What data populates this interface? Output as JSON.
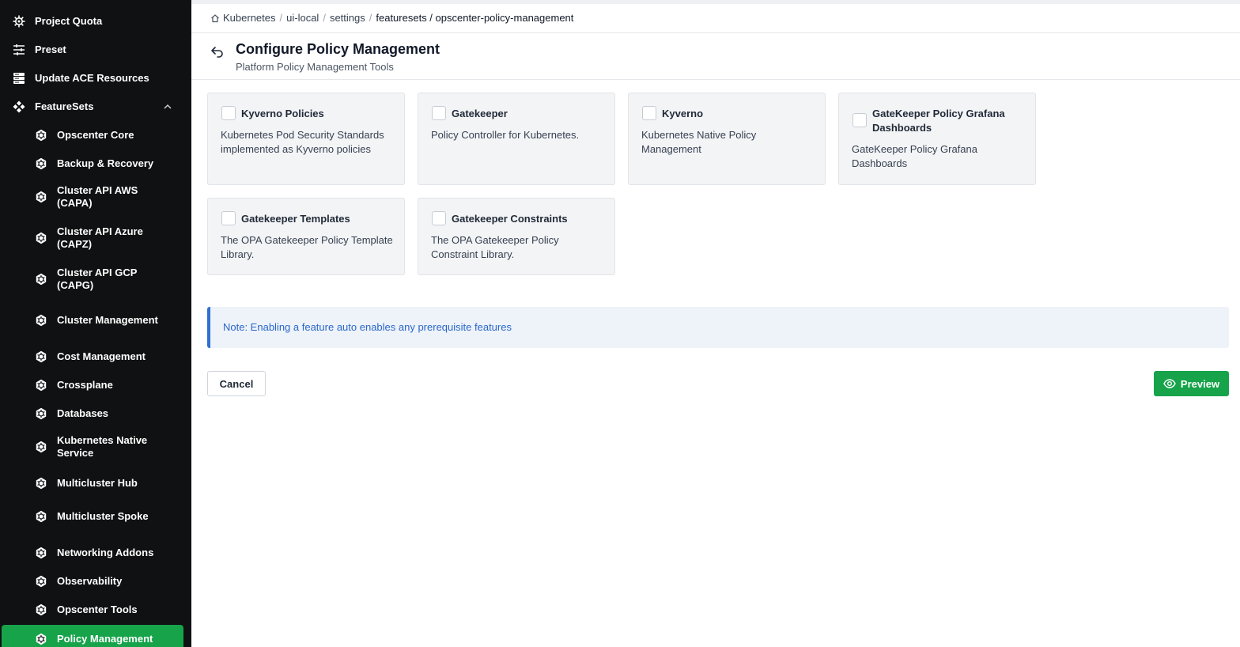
{
  "sidebar": {
    "top_items": [
      {
        "label": "Project Quota",
        "icon": "helm-wheel-icon"
      },
      {
        "label": "Preset",
        "icon": "sliders-icon"
      },
      {
        "label": "Update ACE Resources",
        "icon": "server-stack-icon"
      },
      {
        "label": "FeatureSets",
        "icon": "featuresets-icon",
        "expanded": true
      }
    ],
    "featuresets": [
      {
        "label": "Opscenter Core"
      },
      {
        "label": "Backup & Recovery"
      },
      {
        "label": "Cluster API AWS (CAPA)"
      },
      {
        "label": "Cluster API Azure (CAPZ)"
      },
      {
        "label": "Cluster API GCP (CAPG)"
      },
      {
        "label": "Cluster Management"
      },
      {
        "label": "Cost Management"
      },
      {
        "label": "Crossplane"
      },
      {
        "label": "Databases"
      },
      {
        "label": "Kubernetes Native Service"
      },
      {
        "label": "Multicluster Hub"
      },
      {
        "label": "Multicluster Spoke"
      },
      {
        "label": "Networking Addons"
      },
      {
        "label": "Observability"
      },
      {
        "label": "Opscenter Tools"
      },
      {
        "label": "Policy Management",
        "active": true
      }
    ]
  },
  "breadcrumb": [
    "Kubernetes",
    "ui-local",
    "settings",
    "featuresets / opscenter-policy-management"
  ],
  "header": {
    "title": "Configure Policy Management",
    "subtitle": "Platform Policy Management Tools"
  },
  "features": [
    {
      "title": "Kyverno Policies",
      "description": "Kubernetes Pod Security Standards implemented as Kyverno policies",
      "checked": false
    },
    {
      "title": "Gatekeeper",
      "description": "Policy Controller for Kubernetes.",
      "checked": false
    },
    {
      "title": "Kyverno",
      "description": "Kubernetes Native Policy Management",
      "checked": false
    },
    {
      "title": "GateKeeper Policy Grafana Dashboards",
      "description": "GateKeeper Policy Grafana Dashboards",
      "checked": false
    },
    {
      "title": "Gatekeeper Templates",
      "description": "The OPA Gatekeeper Policy Template Library.",
      "checked": false
    },
    {
      "title": "Gatekeeper Constraints",
      "description": "The OPA Gatekeeper Policy Constraint Library.",
      "checked": false
    }
  ],
  "note": "Note: Enabling a feature auto enables any prerequisite features",
  "actions": {
    "cancel_label": "Cancel",
    "preview_label": "Preview"
  },
  "colors": {
    "sidebar_bg": "#101112",
    "accent_green": "#16a34a",
    "note_blue": "#2a66c9"
  }
}
